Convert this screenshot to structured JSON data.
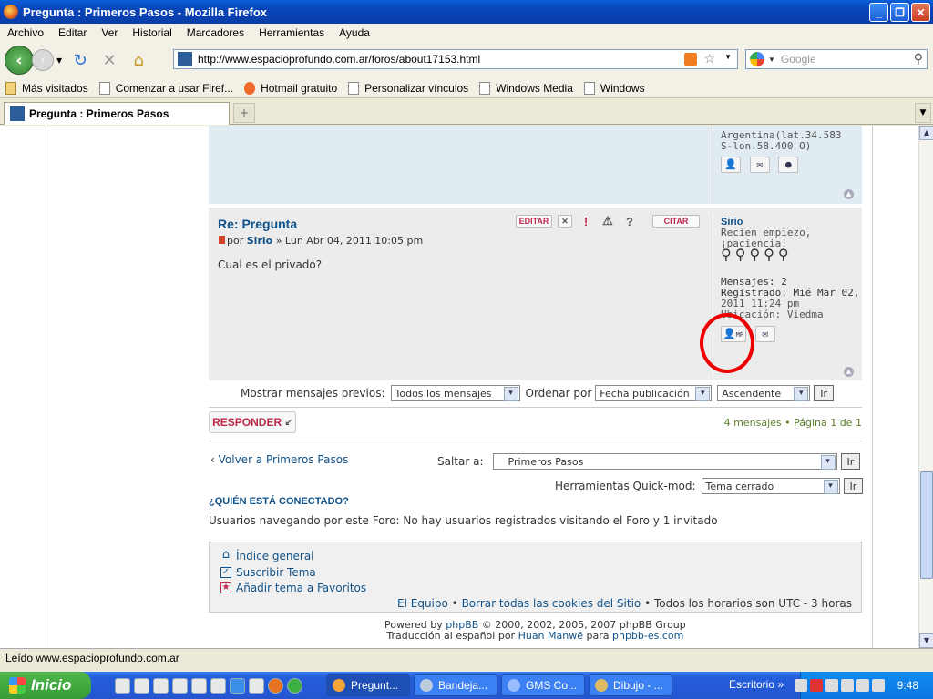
{
  "window": {
    "title": "Pregunta : Primeros Pasos - Mozilla Firefox"
  },
  "menu": [
    "Archivo",
    "Editar",
    "Ver",
    "Historial",
    "Marcadores",
    "Herramientas",
    "Ayuda"
  ],
  "address": {
    "url": "http://www.espacioprofundo.com.ar/foros/about17153.html",
    "search_placeholder": "Google"
  },
  "bookmarks": [
    "Más visitados",
    "Comenzar a usar Firef...",
    "Hotmail gratuito",
    "Personalizar vínculos",
    "Windows Media",
    "Windows"
  ],
  "tab": {
    "label": "Pregunta : Primeros Pasos"
  },
  "post1": {
    "location_line1": "Argentina(lat.34.583",
    "location_line2": "S-lon.58.400 O)"
  },
  "post2": {
    "title": "Re: Pregunta",
    "author_prefix": "por",
    "author": "Sirio",
    "date": "» Lun Abr 04, 2011 10:05 pm",
    "body": "Cual es el privado?",
    "edit_label": "EDITAR",
    "quote_label": "CITAR",
    "profile": {
      "name": "Sirio",
      "rank_line1": "Recien empiezo,",
      "rank_line2": "¡paciencia!",
      "posts": "Mensajes: 2",
      "registered1": "Registrado: Mié Mar 02,",
      "registered2": "2011 11:24 pm",
      "location": "Ubicación: Viedma",
      "pm_label": "MP"
    }
  },
  "sort": {
    "show_label": "Mostrar mensajes previos:",
    "show_value": "Todos los mensajes",
    "order_label": "Ordenar por",
    "order_value": "Fecha publicación",
    "dir_value": "Ascendente",
    "go": "Ir"
  },
  "reply_label": "RESPONDER",
  "pageinfo": "4 mensajes • Página 1 de 1",
  "back_link": "Volver a Primeros Pasos",
  "jump": {
    "label": "Saltar a:",
    "value": "Primeros Pasos",
    "go": "Ir"
  },
  "quickmod": {
    "label": "Herramientas Quick-mod:",
    "value": "Tema cerrado",
    "go": "Ir"
  },
  "online": {
    "heading": "¿QUIÉN ESTÁ CONECTADO?",
    "text": "Usuarios navegando por este Foro: No hay usuarios registrados visitando el Foro y 1 invitado"
  },
  "footer": {
    "index": "Índice general",
    "subscribe": "Suscribir Tema",
    "favorites": "Añadir tema a Favoritos",
    "team": "El Equipo",
    "cookies": "Borrar todas las cookies del Sitio",
    "times": "Todos los horarios son UTC - 3 horas"
  },
  "powered": {
    "line1a": "Powered by",
    "phpbb": "phpBB",
    "line1b": "© 2000, 2002, 2005, 2007 phpBB Group",
    "line2a": "Traducción al español por",
    "translator": "Huan Manwë",
    "line2b": "para",
    "site": "phpbb-es.com"
  },
  "status": "Leído www.espacioprofundo.com.ar",
  "taskbar": {
    "start": "Inicio",
    "tasks": [
      "Pregunt...",
      "Bandeja...",
      "GMS Co...",
      "Dibujo - ..."
    ],
    "desktop": "Escritorio",
    "clock": "9:48"
  }
}
